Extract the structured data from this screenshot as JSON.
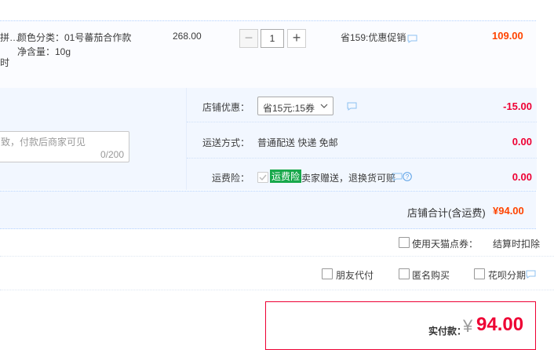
{
  "item": {
    "title_fragment": "拼…",
    "title_fragment2": "时",
    "sku_color": "颜色分类：01号蕃茄合作款",
    "sku_weight": "净含量：10g",
    "unit_price": "268.00",
    "quantity": "1",
    "minus": "−",
    "plus": "+",
    "promo": "省159:优惠促销",
    "subtotal": "109.00"
  },
  "memo": {
    "placeholder": "致，付款后商家可见",
    "counter": "0/200"
  },
  "shop_discount": {
    "label": "店铺优惠：",
    "selected": "省15元:15券",
    "amount": "-15.00"
  },
  "shipping": {
    "label": "运送方式：",
    "value": "普通配送 快递 免邮",
    "amount": "0.00"
  },
  "insurance": {
    "label": "运费险：",
    "badge": "运费险",
    "desc": "卖家赠送，退换货可赔",
    "amount": "0.00"
  },
  "shop_total": {
    "label": "店铺合计(含运费)",
    "amount": "¥94.00"
  },
  "tmall_points": {
    "label": "使用天猫点券：",
    "note": "结算时扣除"
  },
  "options": {
    "friend_pay": "朋友代付",
    "anonymous": "匿名购买",
    "huabei": "花呗分期"
  },
  "payment": {
    "label": "实付款：",
    "currency": "¥",
    "amount": "94.00"
  },
  "colors": {
    "accent_red": "#ee0033",
    "orange": "#ff4400",
    "panel_bg": "#f2f7ff",
    "green_badge": "#18a84b"
  }
}
